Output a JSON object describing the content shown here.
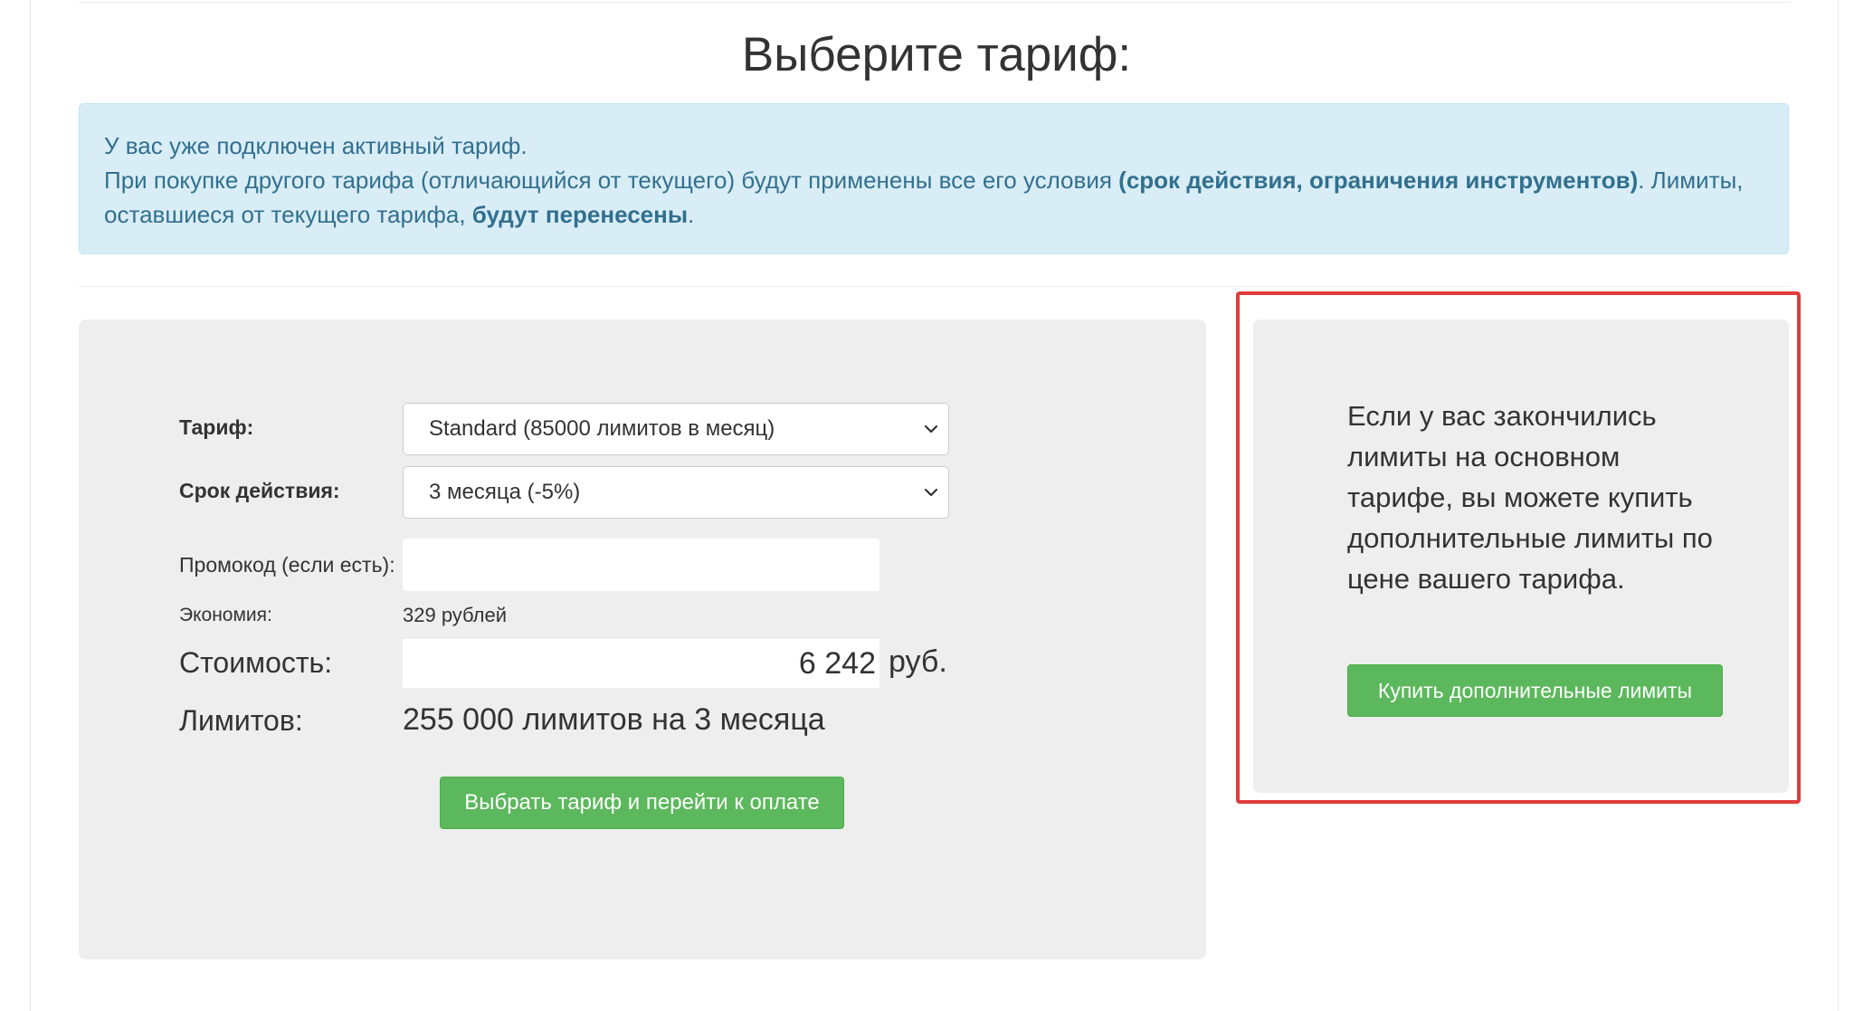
{
  "page": {
    "title": "Выберите тариф:"
  },
  "alert": {
    "line1": "У вас уже подключен активный тариф.",
    "line2_prefix": "При покупке другого тарифа (отличающийся от текущего) будут применены все его условия ",
    "line2_bold": "(срок действия, ограничения инструментов)",
    "line2_suffix": ". Лимиты, оставшиеся от текущего тарифа, ",
    "line3_bold": "будут перенесены",
    "line3_suffix": "."
  },
  "form": {
    "tariff_label": "Тариф:",
    "tariff_value": "Standard (85000 лимитов в месяц)",
    "period_label": "Срок действия:",
    "period_value": "3 месяца (-5%)",
    "promo_label": "Промокод (если есть):",
    "promo_value": "",
    "savings_label": "Экономия:",
    "savings_value": "329 рублей",
    "cost_label": "Стоимость:",
    "cost_value": "6 242",
    "cost_unit": "руб.",
    "limits_label": "Лимитов:",
    "limits_value": "255 000 лимитов на 3 месяца",
    "submit_label": "Выбрать тариф и перейти к оплате"
  },
  "extra": {
    "text": "Если у вас закончились лимиты на основном тарифе, вы можете купить дополнительные лимиты по цене вашего тарифа.",
    "button_label": "Купить дополнительные лимиты"
  },
  "colors": {
    "alert_bg": "#d9edf7",
    "alert_text": "#31708f",
    "button_green": "#5cb85c",
    "highlight_red": "#e03c3c",
    "panel_bg": "#eeeeee"
  }
}
